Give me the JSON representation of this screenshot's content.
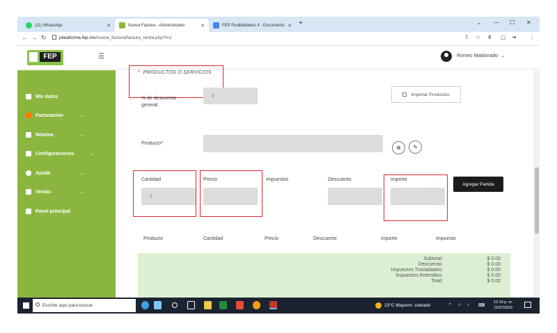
{
  "browser": {
    "tabs": [
      {
        "title": "(11) WhatsApp",
        "icon": "whatsapp-icon",
        "color": "#25d366"
      },
      {
        "title": "Nueva Factura - Administrador",
        "icon": "fep-icon",
        "color": "#8ab63f"
      },
      {
        "title": "FEP Posibilidades 4 - Documento",
        "icon": "doc-icon",
        "color": "#4285f4"
      }
    ],
    "url_host": "plataforma.fep.mx",
    "url_path": "/nueva_factura/factura_venta.php?t=1"
  },
  "header": {
    "logo_text": "FEP",
    "user_name": "Romeo Maldonado"
  },
  "sidebar": {
    "items": [
      {
        "label": "Mis datos",
        "has_chevron": false
      },
      {
        "label": "Facturacion",
        "has_chevron": true
      },
      {
        "label": "Nómina",
        "has_chevron": true
      },
      {
        "label": "Configuraciones",
        "has_chevron": true
      },
      {
        "label": "Ayuda",
        "has_chevron": true
      },
      {
        "label": "Ventas",
        "has_chevron": true
      },
      {
        "label": "Panel principal",
        "has_chevron": false
      }
    ]
  },
  "form": {
    "section_title": "PRODUCTOS O SERVICIOS",
    "discount_label": "% de descuento general",
    "discount_value": "0",
    "import_button": "Importar Productos",
    "product_label": "Producto*",
    "quantity_label": "Cantidad",
    "quantity_value": "1",
    "price_label": "Precio",
    "taxes_label": "Impuestos",
    "discount_col_label": "Descuento",
    "amount_label": "Importe",
    "add_button": "Agregar Partida"
  },
  "table": {
    "headers": [
      "Producto",
      "Cantidad",
      "Precio",
      "Descuento",
      "Importe",
      "Impuesto"
    ]
  },
  "totals": {
    "rows": [
      {
        "label": "Subtotal:",
        "value": "$ 0.00"
      },
      {
        "label": "Descuento:",
        "value": "$ 0.00"
      },
      {
        "label": "Impuestos Trasladados:",
        "value": "$ 0.00"
      },
      {
        "label": "Impuestos Retenidos:",
        "value": "$ 0.00"
      },
      {
        "label": "Total:",
        "value": "$ 0.00"
      }
    ]
  },
  "taskbar": {
    "search_placeholder": "Escribe aquí para buscar",
    "weather": "23°C  Mayorm. soleado",
    "time": "12:14 p. m.",
    "date": "11/07/2022"
  }
}
